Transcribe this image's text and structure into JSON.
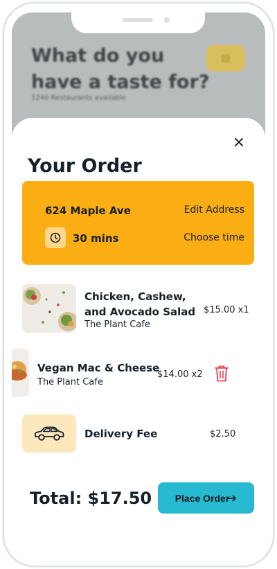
{
  "background": {
    "title": "What do you have a taste for?",
    "subtitle": "1240 Restaurants available"
  },
  "order": {
    "title": "Your Order",
    "close_label": "×",
    "address": "624 Maple Ave",
    "edit_address_label": "Edit Address",
    "time": "30 mins",
    "choose_time_label": "Choose time",
    "items": [
      {
        "name": "Chicken, Cashew, and Avocado Salad",
        "restaurant": "The Plant Cafe",
        "price": "$15.00 x1"
      },
      {
        "name": "Vegan Mac & Cheese",
        "restaurant": "The Plant Cafe",
        "price": "$14.00 x2"
      }
    ],
    "delivery_fee_label": "Delivery Fee",
    "delivery_fee": "$2.50",
    "total": "Total: $17.50",
    "place_order_label": "Place Order"
  },
  "colors": {
    "accent_yellow": "#fbad14",
    "accent_teal": "#27b9cf",
    "delete_red": "#e8404a"
  },
  "icons": [
    "close-icon",
    "clock-icon",
    "trash-icon",
    "car-icon",
    "arrow-right-icon",
    "filter-icon"
  ]
}
